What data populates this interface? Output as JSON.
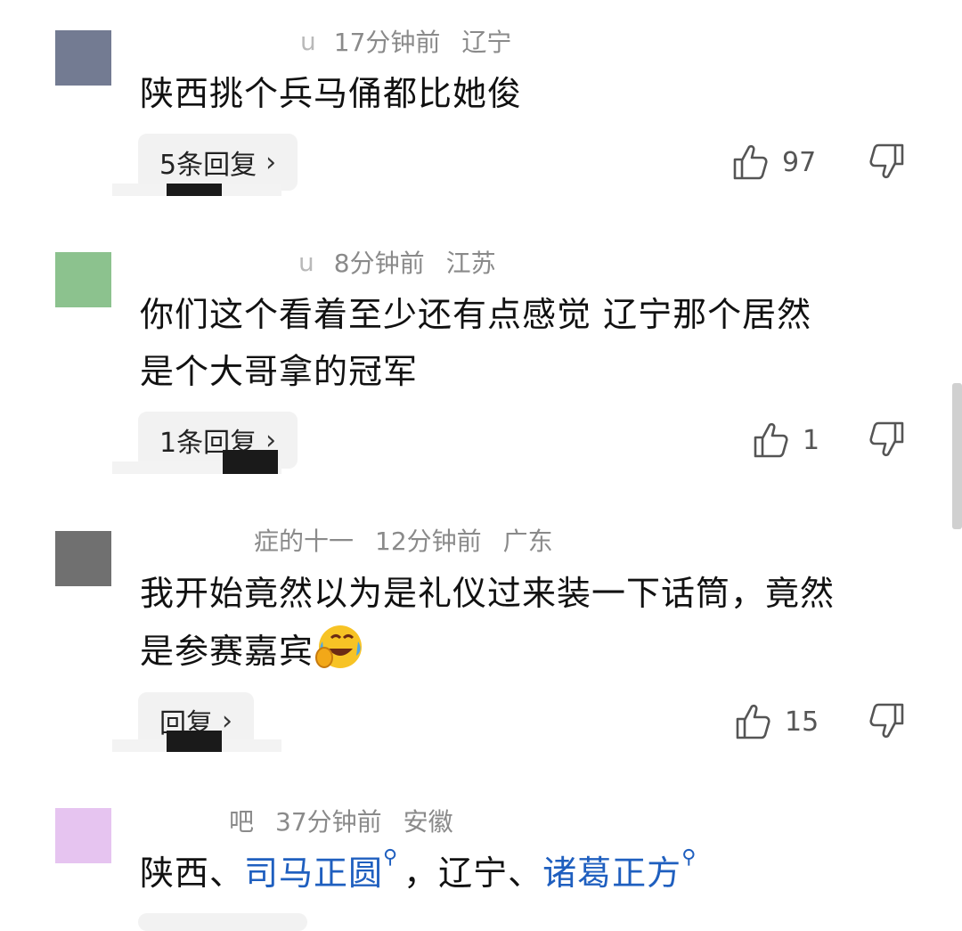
{
  "comments": [
    {
      "name": "u",
      "time": "17分钟前",
      "location": "辽宁",
      "text": "陕西挑个兵马俑都比她俊",
      "reply_label": "5条回复",
      "likes": "97",
      "avatar_color": "#737b92"
    },
    {
      "name": "u",
      "time": "8分钟前",
      "location": "江苏",
      "text_line1": "你们这个看着至少还有点感觉 辽宁那个居然",
      "text_line2": "是个大哥拿的冠军",
      "reply_label": "1条回复",
      "likes": "1",
      "avatar_color": "#8cc28e"
    },
    {
      "name": "症的十一",
      "time": "12分钟前",
      "location": "广东",
      "text_line1": "我开始竟然以为是礼仪过来装一下话筒，竟然",
      "text_line2": "是参赛嘉宾",
      "emoji": "laughing-crying-emoji",
      "reply_label": "回复",
      "likes": "15",
      "avatar_color": "#707070"
    },
    {
      "name": "吧",
      "time": "37分钟前",
      "location": "安徽",
      "text_prefix": "陕西、",
      "link1": "司马正圆",
      "text_mid": "，辽宁、",
      "link2": "诸葛正方",
      "avatar_color": "#e6c4f0"
    }
  ],
  "colors": {
    "link": "#1f5fbf",
    "meta": "#8a8a8a",
    "text": "#111111",
    "reply_bg": "#f2f2f2"
  },
  "icons": {
    "like": "thumbs-up-icon",
    "dislike": "thumbs-down-icon",
    "chevron": "chevron-right-icon",
    "search": "search-icon"
  }
}
